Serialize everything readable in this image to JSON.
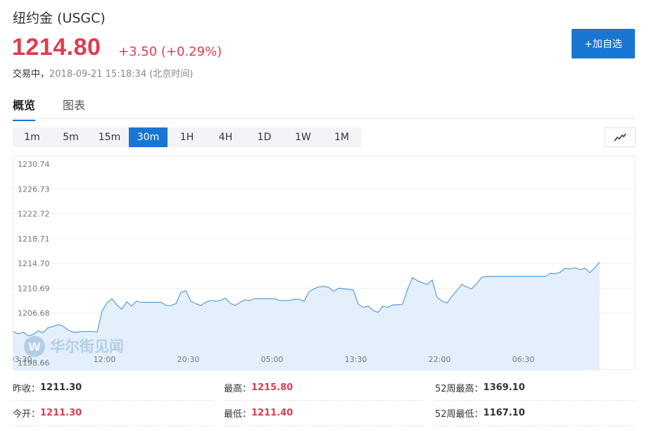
{
  "header": {
    "title": "纽约金  (USGC)",
    "price": "1214.80",
    "change": "+3.50 (+0.29%)",
    "status_label": "交易中，",
    "timestamp": "2018-09-21 15:18:34 (北京时间)",
    "add_watchlist_label": "+加自选"
  },
  "tabs": [
    {
      "label": "概览",
      "active": true
    },
    {
      "label": "图表",
      "active": false
    }
  ],
  "periods": [
    {
      "label": "1m"
    },
    {
      "label": "5m"
    },
    {
      "label": "15m"
    },
    {
      "label": "30m",
      "active": true
    },
    {
      "label": "1H"
    },
    {
      "label": "4H"
    },
    {
      "label": "1D"
    },
    {
      "label": "1W"
    },
    {
      "label": "1M"
    }
  ],
  "chart_toggle_icon": "line-chart-icon",
  "watermark": {
    "text": "华尔街见闻"
  },
  "colors": {
    "accent": "#1976d2",
    "up": "#e03c50",
    "line": "#5b9bd5",
    "fill": "#e3f0fb"
  },
  "chart_data": {
    "type": "area",
    "title": "",
    "xlabel": "",
    "ylabel": "",
    "ylim": [
      1198.66,
      1230.74
    ],
    "y_ticks": [
      "1230.74",
      "1226.73",
      "1222.72",
      "1218.71",
      "1214.70",
      "1210.69",
      "1206.68",
      "1198.66"
    ],
    "x_ticks": [
      "03:30",
      "12:00",
      "20:30",
      "05:00",
      "13:30",
      "22:00",
      "06:30"
    ],
    "x_tick_positions": [
      1.5,
      18.5,
      35.5,
      52.5,
      69.5,
      86.5,
      103.5
    ],
    "grid": true,
    "series": [
      {
        "values": [
          1203.7,
          1203.3,
          1203.6,
          1203.0,
          1203.2,
          1203.8,
          1203.5,
          1204.3,
          1204.5,
          1204.8,
          1204.6,
          1204.0,
          1203.6,
          1203.6,
          1203.7,
          1203.7,
          1203.7,
          1203.6,
          1207.0,
          1208.3,
          1209.0,
          1208.0,
          1207.3,
          1208.5,
          1207.8,
          1208.6,
          1208.4,
          1208.4,
          1208.4,
          1208.4,
          1208.4,
          1207.9,
          1207.9,
          1208.2,
          1210.0,
          1210.3,
          1208.6,
          1208.2,
          1207.9,
          1208.4,
          1208.7,
          1208.6,
          1208.7,
          1209.1,
          1208.3,
          1207.9,
          1208.4,
          1208.8,
          1208.7,
          1209.0,
          1209.0,
          1209.0,
          1209.0,
          1209.0,
          1208.7,
          1208.7,
          1208.7,
          1208.9,
          1208.9,
          1208.6,
          1210.1,
          1210.6,
          1210.9,
          1211.0,
          1210.8,
          1210.2,
          1210.7,
          1210.6,
          1210.5,
          1210.4,
          1208.1,
          1207.6,
          1207.8,
          1207.1,
          1206.8,
          1207.8,
          1207.6,
          1208.0,
          1208.0,
          1208.1,
          1210.5,
          1212.4,
          1211.9,
          1211.6,
          1211.3,
          1212.0,
          1209.2,
          1208.6,
          1208.3,
          1209.4,
          1210.3,
          1211.3,
          1210.9,
          1210.6,
          1211.4,
          1212.4,
          1212.6,
          1212.6,
          1212.6,
          1212.6,
          1212.6,
          1212.6,
          1212.6,
          1212.6,
          1212.6,
          1212.6,
          1212.6,
          1212.6,
          1212.6,
          1213.1,
          1213.0,
          1213.3,
          1213.9,
          1213.8,
          1214.0,
          1213.7,
          1213.9,
          1213.2,
          1214.0,
          1214.9
        ]
      }
    ]
  },
  "stats": [
    {
      "label": "昨收：",
      "value": "1211.30",
      "red": false
    },
    {
      "label": "最高：",
      "value": "1215.80",
      "red": true
    },
    {
      "label": "52周最高：",
      "value": "1369.10",
      "red": false
    },
    {
      "label": "今开：",
      "value": "1211.30",
      "red": true
    },
    {
      "label": "最低：",
      "value": "1211.40",
      "red": true
    },
    {
      "label": "52周最低：",
      "value": "1167.10",
      "red": false
    }
  ]
}
